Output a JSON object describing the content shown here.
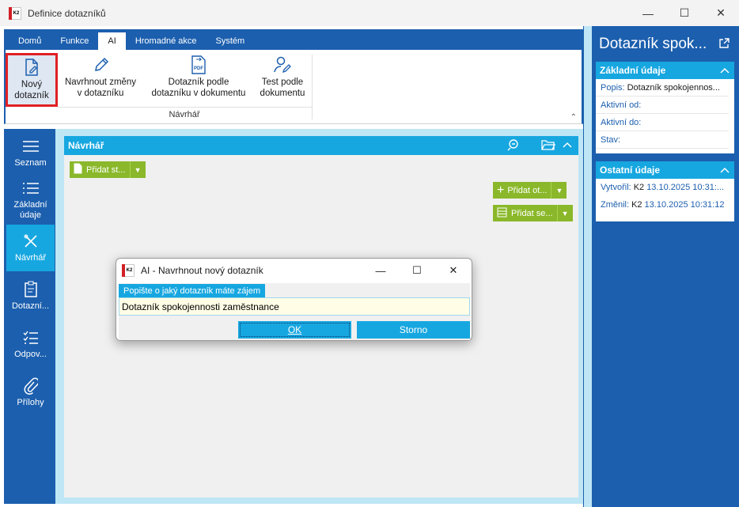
{
  "window": {
    "title": "Definice dotazníků",
    "app_icon_text": "K2"
  },
  "tabs": [
    {
      "label": "Domů"
    },
    {
      "label": "Funkce"
    },
    {
      "label": "AI"
    },
    {
      "label": "Hromadné akce"
    },
    {
      "label": "Systém"
    }
  ],
  "ribbon": {
    "buttons": [
      {
        "line1": "Nový",
        "line2": "dotazník",
        "icon": "new-document-icon"
      },
      {
        "line1": "Navrhnout změny",
        "line2": "v dotazníku",
        "icon": "pencil-icon"
      },
      {
        "line1": "Dotazník podle",
        "line2": "dotazníku v dokumentu",
        "icon": "pdf-icon"
      },
      {
        "line1": "Test podle",
        "line2": "dokumentu",
        "icon": "user-edit-icon"
      }
    ],
    "group_label": "Návrhář"
  },
  "leftnav": [
    {
      "label": "Seznam",
      "icon": "hamburger-icon"
    },
    {
      "label": "Základní údaje",
      "icon": "list-icon"
    },
    {
      "label": "Návrhář",
      "icon": "tools-icon"
    },
    {
      "label": "Dotazní...",
      "icon": "clipboard-icon"
    },
    {
      "label": "Odpov...",
      "icon": "checklist-icon"
    },
    {
      "label": "Přílohy",
      "icon": "paperclip-icon"
    }
  ],
  "panel": {
    "title": "Návrhář",
    "add_button": "Přidat st...",
    "add_question_button": "Přidat ot...",
    "add_section_button": "Přidat se..."
  },
  "right_pane": {
    "title": "Dotazník spok...",
    "basic": {
      "title": "Základní údaje",
      "popis_label": "Popis:",
      "popis_value": "Dotazník spokojennos...",
      "aktivni_od_label": "Aktivní od:",
      "aktivni_do_label": "Aktivní do:",
      "stav_label": "Stav:"
    },
    "other": {
      "title": "Ostatní údaje",
      "vytvoril_label": "Vytvořil:",
      "vytvoril_user": "K2",
      "vytvoril_date": "13.10.2025 10:31:...",
      "zmenil_label": "Změnil:",
      "zmenil_user": "K2",
      "zmenil_date": "13.10.2025 10:31:12"
    }
  },
  "dialog": {
    "title": "AI - Navrhnout nový dotazník",
    "field_label": "Popište o jaký dotazník máte zájem",
    "field_value": "Dotazník spokojennosti zaměstnance",
    "ok": "OK",
    "cancel": "Storno"
  }
}
